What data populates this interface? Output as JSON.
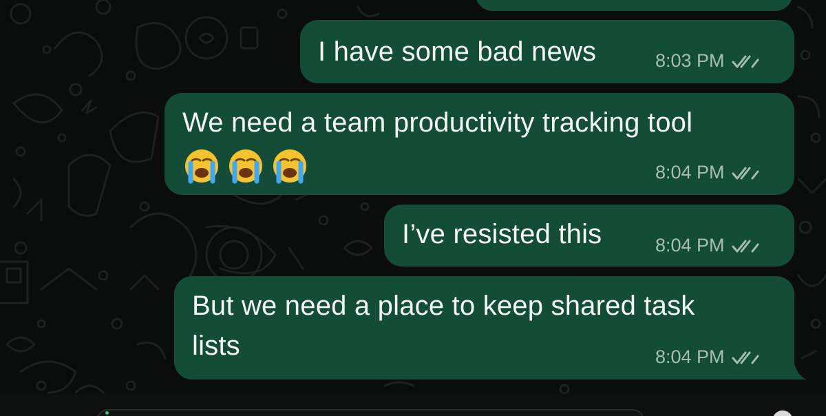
{
  "chat": {
    "messages": [
      {
        "text": "I have some bad news",
        "time": "8:03 PM"
      },
      {
        "text": "We need a team productivity tracking tool",
        "emoji": [
          "😭",
          "😭",
          "😭"
        ],
        "time": "8:04 PM"
      },
      {
        "text": "I’ve resisted this",
        "time": "8:04 PM"
      },
      {
        "line1": "But we need a place to keep shared task",
        "line2": "lists",
        "time": "8:04 PM"
      }
    ],
    "status": "read",
    "icons": {
      "receipt": "double-check-icon",
      "emoji": "loudly-crying-face-icon",
      "send": "microphone-icon"
    }
  },
  "colors": {
    "background": "#0b0c0c",
    "bubble": "#134d37",
    "text": "#f3f6f4",
    "meta": "#a6bdb2"
  }
}
